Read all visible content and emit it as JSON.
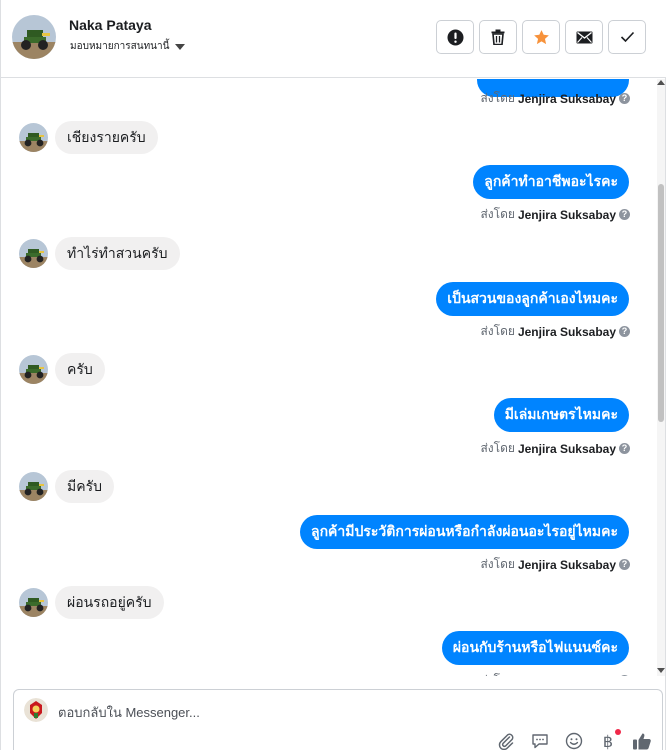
{
  "header": {
    "name": "Naka Pataya",
    "assign_label": "มอบหมายการสนทนานี้",
    "actions": [
      {
        "icon": "alert-icon",
        "label": "mark-spam"
      },
      {
        "icon": "trash-icon",
        "label": "delete"
      },
      {
        "icon": "star-icon",
        "label": "star"
      },
      {
        "icon": "envelope-icon",
        "label": "mark-unread"
      },
      {
        "icon": "check-icon",
        "label": "done"
      }
    ]
  },
  "conversation": {
    "sent_by_prefix": "ส่งโดย",
    "sender_name": "Jenjira Suksabay",
    "messages": [
      {
        "direction": "out",
        "text": ""
      },
      {
        "direction": "in",
        "text": "เชียงรายครับ"
      },
      {
        "direction": "out",
        "text": "ลูกค้าทำอาชีพอะไรคะ"
      },
      {
        "direction": "in",
        "text": "ทำไร่ทำสวนครับ"
      },
      {
        "direction": "out",
        "text": "เป็นสวนของลูกค้าเองไหมคะ"
      },
      {
        "direction": "in",
        "text": "ครับ"
      },
      {
        "direction": "out",
        "text": "มีเล่มเกษตรไหมคะ"
      },
      {
        "direction": "in",
        "text": "มีครับ"
      },
      {
        "direction": "out",
        "text": "ลูกค้ามีประวัติการผ่อนหรือกำลังผ่อนอะไรอยู่ไหมคะ"
      },
      {
        "direction": "in",
        "text": "ผ่อนรถอยู่ครับ"
      },
      {
        "direction": "out",
        "text": "ผ่อนกับร้านหรือไฟแนนซ์คะ"
      }
    ]
  },
  "composer": {
    "placeholder": "ตอบกลับใน Messenger...",
    "tools": [
      "paperclip-icon",
      "saved-reply-icon",
      "emoji-icon",
      "payment-baht-icon",
      "like-icon"
    ]
  },
  "colors": {
    "accent": "#0084ff",
    "incoming_bubble": "#f1f0f0",
    "star": "#f7923b",
    "notification_dot": "#f02849"
  }
}
